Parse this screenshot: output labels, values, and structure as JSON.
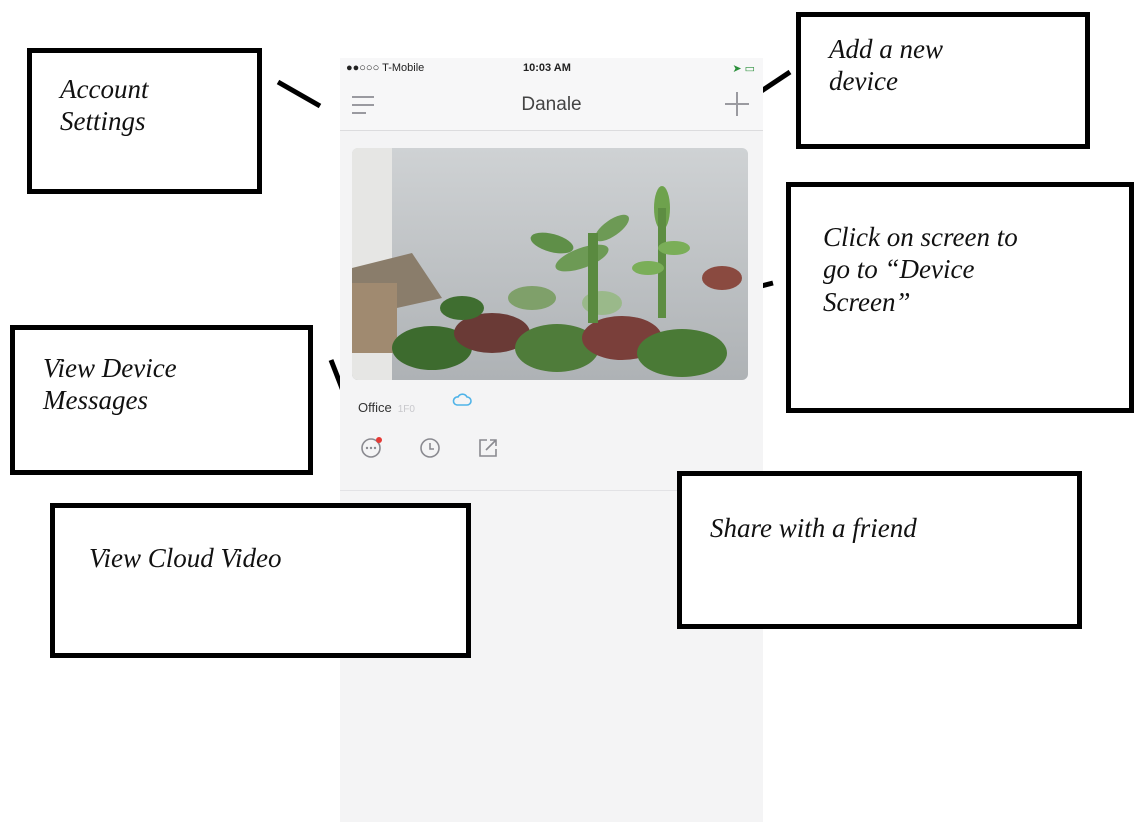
{
  "status_bar": {
    "carrier": "●●○○○ T-Mobile",
    "time": "10:03 AM"
  },
  "nav": {
    "title": "Danale"
  },
  "device": {
    "name": "Office",
    "version": "1F0"
  },
  "annotations": {
    "account_settings": "Account\nSettings",
    "add_device": "Add a new\ndevice",
    "device_screen": "Click on screen to\ngo to “Device\nScreen”",
    "device_messages": "View Device\nMessages",
    "cloud_video": "View Cloud Video",
    "share": "Share with a friend"
  },
  "icons": {
    "menu": "menu-icon",
    "add": "plus-icon",
    "cloud": "cloud-icon",
    "messages": "message-icon",
    "cloud_video": "clock-icon",
    "share": "share-icon"
  },
  "colors": {
    "accent": "#4fb3e8",
    "badge": "#e53935",
    "icon_gray": "#9a9aa0"
  }
}
